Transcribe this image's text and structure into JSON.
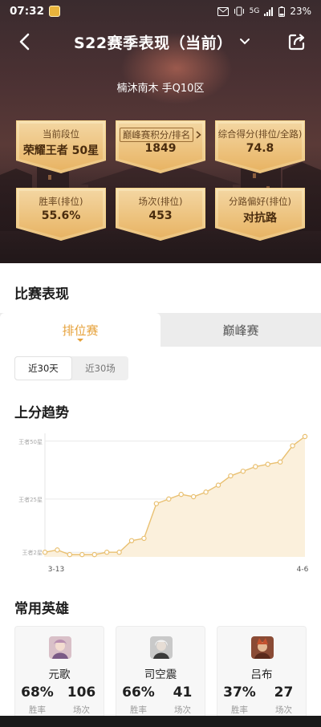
{
  "status_bar": {
    "time": "07:32",
    "battery": "23%",
    "network": "5G"
  },
  "nav": {
    "title": "S22赛季表现（当前）"
  },
  "player": {
    "name_region": "楠沐南木  手Q10区"
  },
  "stat_cards": [
    {
      "label": "当前段位",
      "value": "荣耀王者 50星",
      "has_arrow": false
    },
    {
      "label": "巅峰赛积分/排名",
      "value": "1849",
      "has_arrow": true
    },
    {
      "label": "综合得分(排位/全路)",
      "value": "74.8",
      "has_arrow": false
    },
    {
      "label": "胜率(排位)",
      "value": "55.6%",
      "has_arrow": false
    },
    {
      "label": "场次(排位)",
      "value": "453",
      "has_arrow": false
    },
    {
      "label": "分路偏好(排位)",
      "value": "对抗路",
      "has_arrow": false
    }
  ],
  "match_section": {
    "title": "比赛表现",
    "tabs": [
      "排位赛",
      "巅峰赛"
    ],
    "active_tab": 0,
    "filters": [
      "近30天",
      "近30场"
    ],
    "active_filter": 0
  },
  "trend": {
    "title": "上分趋势"
  },
  "chart_data": {
    "type": "area",
    "title": "上分趋势",
    "x_start_label": "3-13",
    "x_end_label": "4-6",
    "y_tick_labels": [
      "王者50星",
      "王者25星",
      "王者2星"
    ],
    "y_ticks": [
      50,
      25,
      2
    ],
    "ylim": [
      0,
      52
    ],
    "values": [
      2,
      3,
      1,
      1,
      1,
      2,
      2,
      7,
      8,
      23,
      25,
      27,
      26,
      28,
      31,
      35,
      37,
      39,
      40,
      41,
      48,
      52
    ],
    "color": "#e9c071",
    "fill": "#fbf0dc"
  },
  "heroes_section": {
    "title": "常用英雄",
    "heroes": [
      {
        "name": "元歌",
        "win_rate": "68%",
        "games": "106",
        "win_cap": "胜率",
        "games_cap": "场次",
        "avatar": "avatar-yuange"
      },
      {
        "name": "司空震",
        "win_rate": "66%",
        "games": "41",
        "win_cap": "胜率",
        "games_cap": "场次",
        "avatar": "avatar-sikongzhen"
      },
      {
        "name": "吕布",
        "win_rate": "37%",
        "games": "27",
        "win_cap": "胜率",
        "games_cap": "场次",
        "avatar": "avatar-lvbu"
      }
    ]
  },
  "colors": {
    "accent": "#e6a13a",
    "card_gold": "#ecc37d"
  }
}
